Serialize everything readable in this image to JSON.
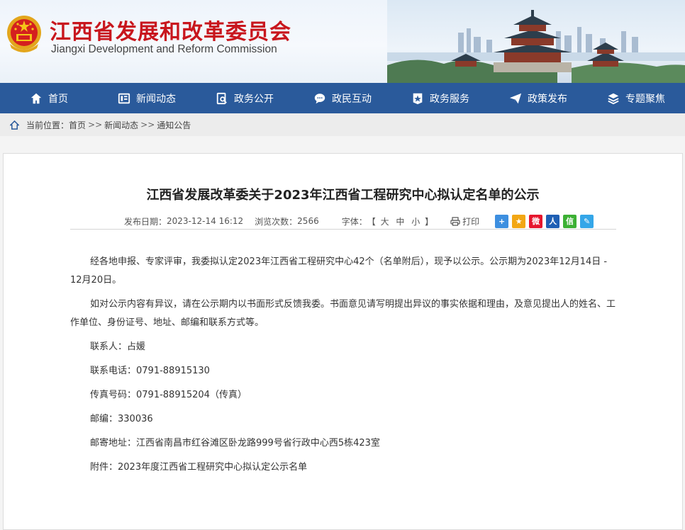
{
  "header": {
    "title_cn": "江西省发展和改革委员会",
    "title_en": "Jiangxi Development and Reform Commission"
  },
  "nav": [
    {
      "label": "首页",
      "icon": "home-icon"
    },
    {
      "label": "新闻动态",
      "icon": "news-icon"
    },
    {
      "label": "政务公开",
      "icon": "document-search-icon"
    },
    {
      "label": "政民互动",
      "icon": "chat-icon"
    },
    {
      "label": "政务服务",
      "icon": "star-badge-icon"
    },
    {
      "label": "政策发布",
      "icon": "paper-plane-icon"
    },
    {
      "label": "专题聚焦",
      "icon": "layers-icon"
    }
  ],
  "breadcrumb": {
    "prefix": "当前位置：",
    "items": [
      "首页",
      "新闻动态",
      "通知公告"
    ],
    "sep": ">>"
  },
  "article": {
    "title": "江西省发展改革委关于2023年江西省工程研究中心拟认定名单的公示",
    "meta": {
      "date_label": "发布日期：",
      "date": "2023-12-14 16:12",
      "views_label": "浏览次数：",
      "views": "2566",
      "font_label": "字体：",
      "font_open": "【",
      "font_large": "大",
      "font_medium": "中",
      "font_small": "小",
      "font_close": "】",
      "print": "打印"
    },
    "share": [
      {
        "icon": "share-plus-icon",
        "color": "#3d8fe0",
        "glyph": "+"
      },
      {
        "icon": "qzone-star-icon",
        "color": "#f2a714",
        "glyph": "★"
      },
      {
        "icon": "weibo-icon",
        "color": "#e6162d",
        "glyph": "微"
      },
      {
        "icon": "renren-icon",
        "color": "#1f5fb4",
        "glyph": "人"
      },
      {
        "icon": "wechat-icon",
        "color": "#3cb034",
        "glyph": "信"
      },
      {
        "icon": "edit-note-icon",
        "color": "#34a6e8",
        "glyph": "✎"
      }
    ],
    "paragraphs": [
      "经各地申报、专家评审，我委拟认定2023年江西省工程研究中心42个（名单附后），现予以公示。公示期为2023年12月14日 - 12月20日。",
      "如对公示内容有异议，请在公示期内以书面形式反馈我委。书面意见请写明提出异议的事实依据和理由，及意见提出人的姓名、工作单位、身份证号、地址、邮编和联系方式等。"
    ],
    "contact": [
      "联系人：占媛",
      "联系电话：0791-88915130",
      "传真号码：0791-88915204（传真）",
      "邮编：330036",
      "邮寄地址：江西省南昌市红谷滩区卧龙路999号省行政中心西5栋423室",
      "附件：2023年度江西省工程研究中心拟认定公示名单"
    ]
  },
  "colors": {
    "nav_bg": "#2a5a9b",
    "brand_red": "#c8161d",
    "breadcrumb_bg": "#ececec"
  }
}
